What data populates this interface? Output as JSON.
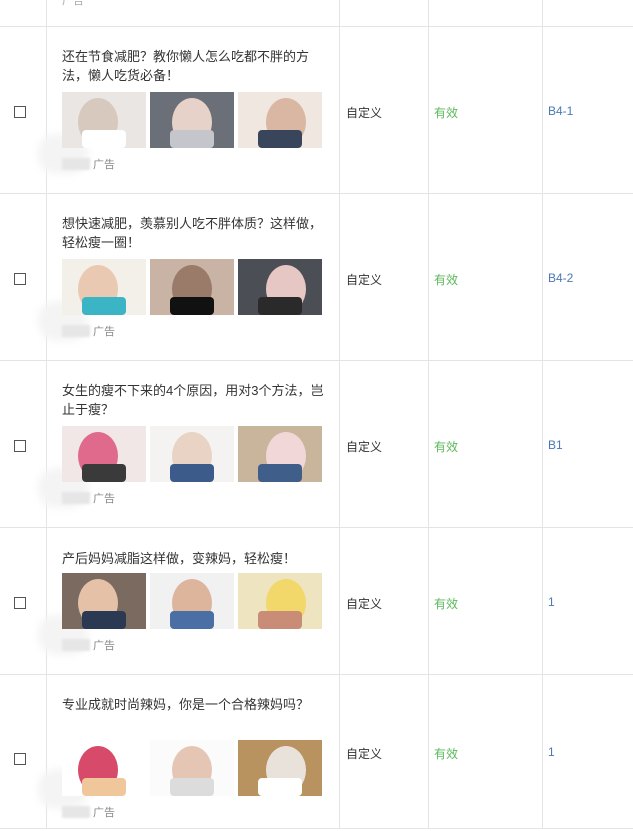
{
  "top_row": {
    "partial_label": "广告"
  },
  "rows": [
    {
      "title": "还在节食减肥？教你懒人怎么吃都不胖的方法，懒人吃货必备！",
      "ad_label": "广告",
      "type": "自定义",
      "status": "有效",
      "code": "B4-1",
      "thumbs": [
        {
          "icon": "photo-woman-selfie",
          "colors": [
            "#e9e6e3",
            "#d8c9bf",
            "#ffffff"
          ]
        },
        {
          "icon": "photo-woman-white-top",
          "colors": [
            "#6b6f78",
            "#e6d2c8",
            "#c4c6cc"
          ]
        },
        {
          "icon": "photo-waist-jeans",
          "colors": [
            "#f0e7e1",
            "#d9b7a3",
            "#38455a"
          ]
        }
      ]
    },
    {
      "title": "想快速减肥，羡慕别人吃不胖体质？这样做，轻松瘦一圈！",
      "ad_label": "广告",
      "type": "自定义",
      "status": "有效",
      "code": "B4-2",
      "thumbs": [
        {
          "icon": "photo-measuring-tape",
          "colors": [
            "#f3efe9",
            "#e9c9b2",
            "#3bb5c6"
          ]
        },
        {
          "icon": "photo-abs-sports-bra",
          "colors": [
            "#c9b3a5",
            "#9a7a68",
            "#111111"
          ]
        },
        {
          "icon": "photo-woman-gym",
          "colors": [
            "#4b4f55",
            "#e6c7c3",
            "#2a2a2a"
          ]
        }
      ]
    },
    {
      "title": "女生的瘦不下来的4个原因，用对3个方法，岂止于瘦？",
      "ad_label": "广告",
      "type": "自定义",
      "status": "有效",
      "code": "B1",
      "thumbs": [
        {
          "icon": "photo-pink-sports-bra",
          "colors": [
            "#f1e7e6",
            "#e06a8b",
            "#3a3a3a"
          ]
        },
        {
          "icon": "photo-crop-top-jeans",
          "colors": [
            "#f5f3f1",
            "#e8d3c5",
            "#3c5a8a"
          ]
        },
        {
          "icon": "photo-woman-stairs",
          "colors": [
            "#c8b59c",
            "#f1d7d7",
            "#3f5f8a"
          ]
        }
      ]
    },
    {
      "title": "产后妈妈减脂这样做，变辣妈，轻松瘦！",
      "ad_label": "广告",
      "type": "自定义",
      "status": "有效",
      "code": "1",
      "thumbs": [
        {
          "icon": "photo-belly-jeans",
          "colors": [
            "#7a6a60",
            "#e5c1a7",
            "#2b3a52"
          ]
        },
        {
          "icon": "photo-belly-tape",
          "colors": [
            "#f1f1f1",
            "#dcb59c",
            "#4a6fa5"
          ]
        },
        {
          "icon": "photo-yoga-woman",
          "colors": [
            "#efe4c0",
            "#f2d76a",
            "#c98c76"
          ]
        }
      ]
    },
    {
      "title": "专业成就时尚辣妈，你是一个合格辣妈吗？",
      "ad_label": "广告",
      "type": "自定义",
      "status": "有效",
      "code": "1",
      "thumbs": [
        {
          "icon": "photo-woman-pink-sports",
          "colors": [
            "#ffffff",
            "#d84a6a",
            "#f0c79a"
          ]
        },
        {
          "icon": "photo-waist-measure",
          "colors": [
            "#fbfbfb",
            "#e5c6b5",
            "#dcdcdc"
          ]
        },
        {
          "icon": "photo-bathroom-scale",
          "colors": [
            "#b8925f",
            "#e9e2da",
            "#ffffff"
          ]
        }
      ]
    }
  ],
  "colors": {
    "status_valid": "#5cb85c",
    "code_link": "#4a78b5",
    "border": "#e4e4e4"
  }
}
